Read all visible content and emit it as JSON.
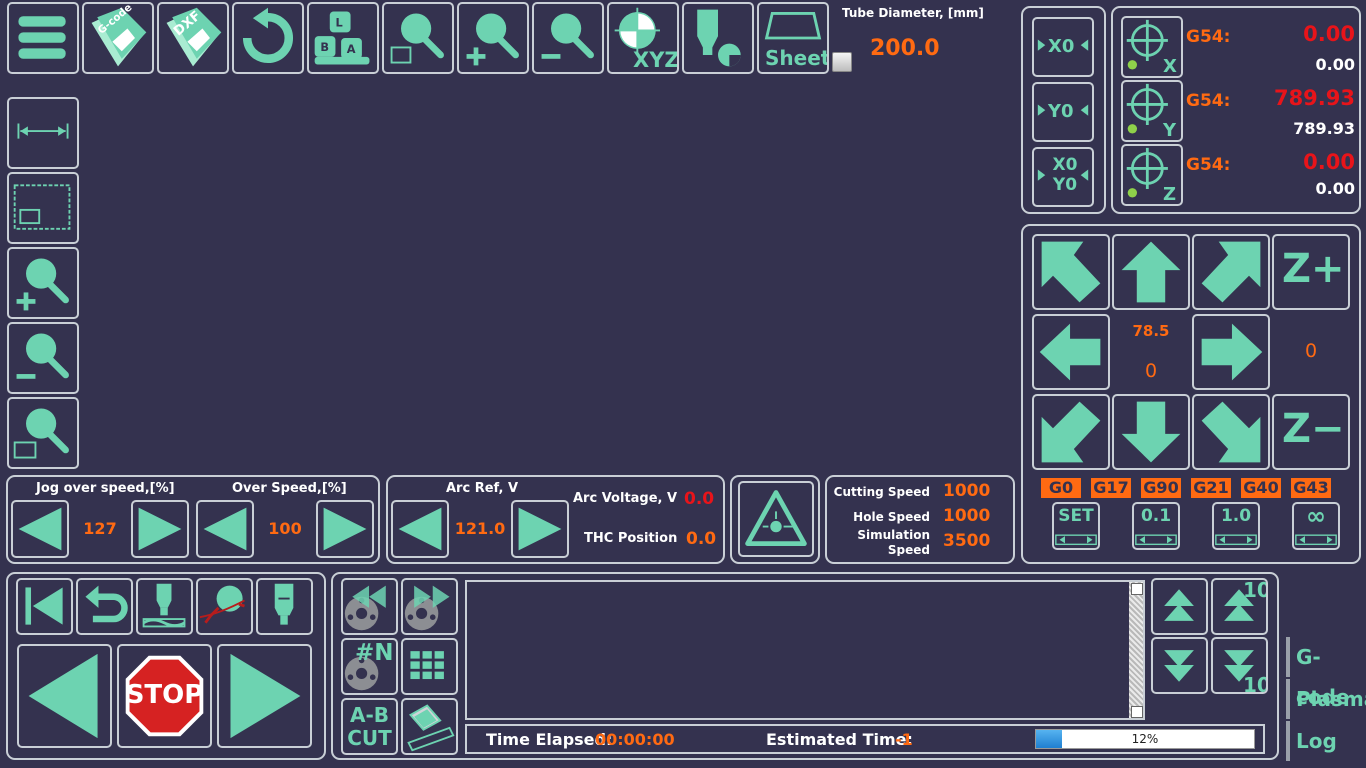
{
  "toolbar": {
    "menu_icon": "hamburger-menu-icon",
    "gcode_label": "G-code",
    "dxf_label": "DXF",
    "keyboard_keys": [
      "L",
      "B",
      "A"
    ],
    "xyz_label": "XYZ",
    "sheet_label": "Sheet"
  },
  "tube": {
    "label": "Tube Diameter, [mm]",
    "value": "200.0"
  },
  "axes": {
    "zero_buttons": [
      "X0",
      "Y0",
      "X0 Y0"
    ],
    "rows": [
      {
        "axis": "X",
        "g54_label": "G54:",
        "g54_value": "0.00",
        "machine_value": "0.00"
      },
      {
        "axis": "Y",
        "g54_label": "G54:",
        "g54_value": "789.93",
        "machine_value": "789.93"
      },
      {
        "axis": "Z",
        "g54_label": "G54:",
        "g54_value": "0.00",
        "machine_value": "0.00"
      }
    ]
  },
  "jog": {
    "z_plus": "Z+",
    "z_minus": "Z−",
    "center_top": "78.5",
    "center_bottom": "0",
    "z_value": "0",
    "gcodes": [
      "G0",
      "G17",
      "G90",
      "G21",
      "G40",
      "G43"
    ],
    "step_buttons": [
      "SET",
      "0.1",
      "1.0",
      "∞"
    ]
  },
  "speed_panel": {
    "jog_over_label": "Jog over speed,[%]",
    "jog_over_value": "127",
    "over_speed_label": "Over Speed,[%]",
    "over_speed_value": "100"
  },
  "arc_panel": {
    "arc_ref_label": "Arc Ref, V",
    "arc_ref_value": "121.0",
    "arc_voltage_label": "Arc Voltage, V",
    "arc_voltage_value": "0.0",
    "thc_label": "THC Position",
    "thc_value": "0.0"
  },
  "cut_panel": {
    "cutting_speed_label": "Cutting Speed",
    "cutting_speed_value": "1000",
    "hole_speed_label": "Hole Speed",
    "hole_speed_value": "1000",
    "simulation_speed_label": "Simulation Speed",
    "simulation_speed_value": "3500"
  },
  "control": {
    "stop_label": "STOP"
  },
  "program": {
    "n_label": "#N",
    "ab_cut_label_1": "A-B",
    "ab_cut_label_2": "CUT",
    "scroll_ten_up": "10",
    "scroll_ten_down": "10",
    "time_elapsed_label": "Time Elapsed:",
    "time_elapsed_value": "00:00:00",
    "estimated_label": "Estimated Time:",
    "estimated_value": "-1",
    "progress_text": "12%",
    "progress": 0.12
  },
  "tabs": [
    "G-code",
    "Plasma",
    "Log"
  ],
  "colors": {
    "background": "#34324f",
    "accent": "#6dd3b1",
    "orange": "#ff6a12",
    "red": "#e8141a",
    "border": "#c9cfd6"
  }
}
